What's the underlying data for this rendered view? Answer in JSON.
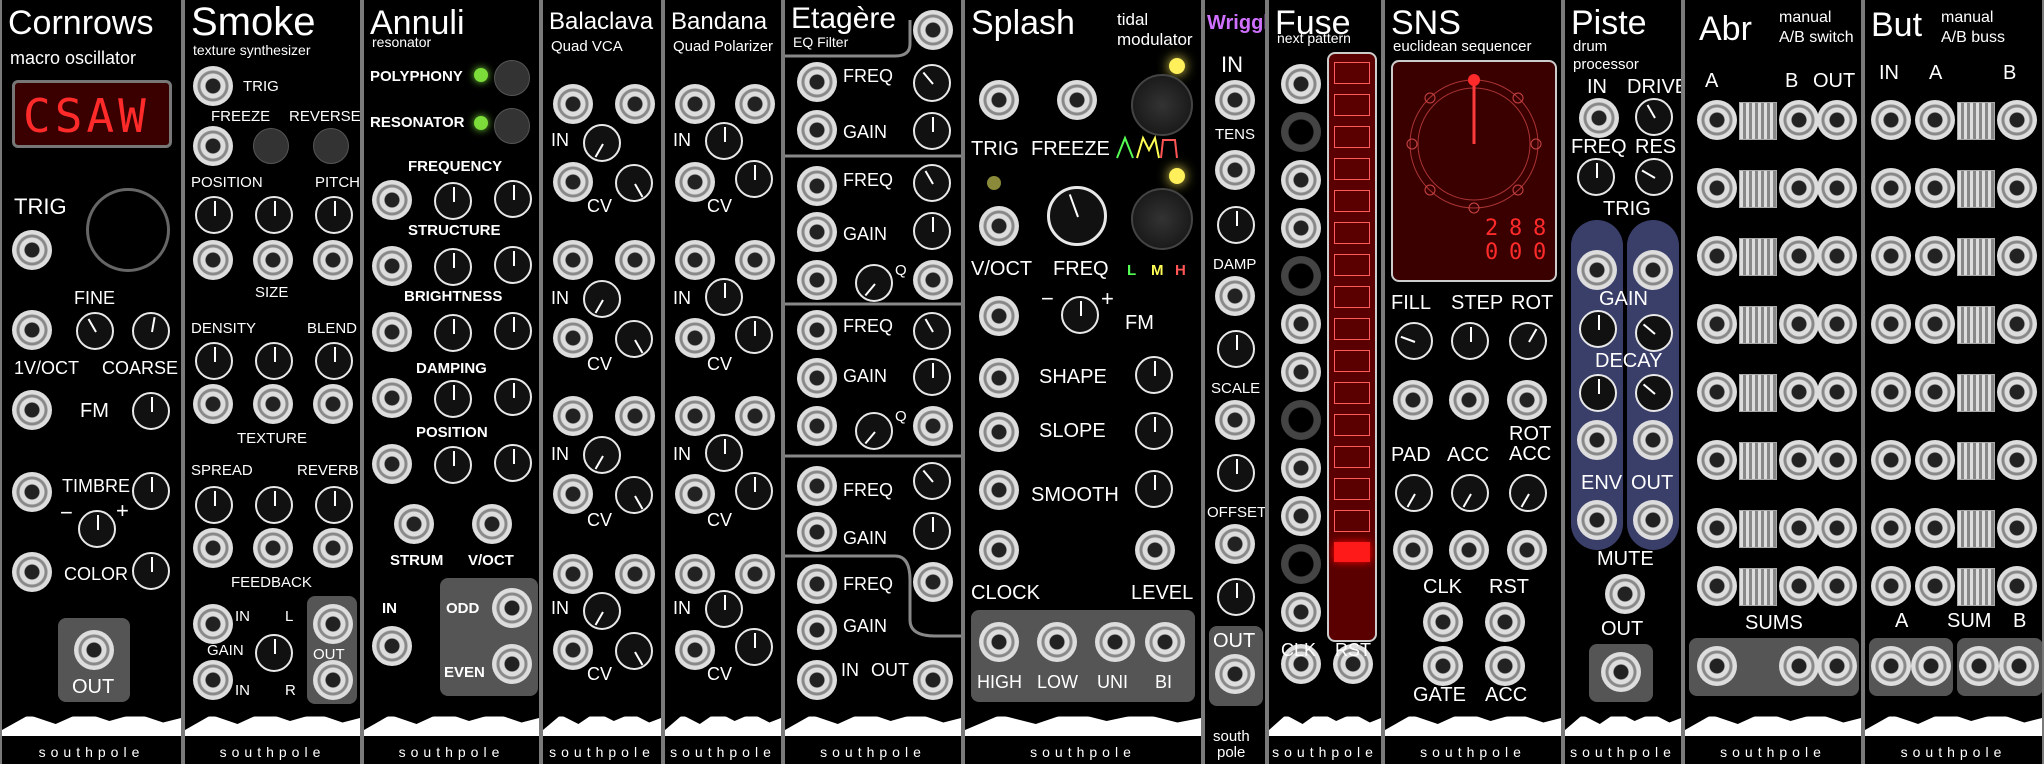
{
  "brand": "southpole",
  "modules": {
    "cornrows": {
      "title": "Cornrows",
      "subtitle": "macro oscillator",
      "display": "CSAW",
      "labels": {
        "trig": "TRIG",
        "fine": "FINE",
        "voct": "1V/OCT",
        "coarse": "COARSE",
        "fm": "FM",
        "timbre": "TIMBRE",
        "minus": "−",
        "plus": "+",
        "color": "COLOR",
        "out": "OUT"
      }
    },
    "smoke": {
      "title": "Smoke",
      "subtitle": "texture synthesizer",
      "labels": {
        "trig": "TRIG",
        "freeze": "FREEZE",
        "reverse": "REVERSE",
        "position": "POSITION",
        "pitch": "PITCH",
        "size": "SIZE",
        "density": "DENSITY",
        "blend": "BLEND",
        "texture": "TEXTURE",
        "spread": "SPREAD",
        "reverb": "REVERB",
        "feedback": "FEEDBACK",
        "in": "IN",
        "l": "L",
        "gain": "GAIN",
        "in2": "IN",
        "r": "R",
        "out": "OUT"
      }
    },
    "annuli": {
      "title": "Annuli",
      "subtitle": "resonator",
      "labels": {
        "polyphony": "POLYPHONY",
        "resonator": "RESONATOR",
        "frequency": "FREQUENCY",
        "structure": "STRUCTURE",
        "brightness": "BRIGHTNESS",
        "damping": "DAMPING",
        "position": "POSITION",
        "minus": "-",
        "plus": "+",
        "strum": "STRUM",
        "voct": "V/OCT",
        "in": "IN",
        "odd": "ODD",
        "even": "EVEN"
      }
    },
    "balaclava": {
      "title": "Balaclava",
      "subtitle": "Quad VCA",
      "labels": {
        "in": "IN",
        "cv": "CV"
      }
    },
    "bandana": {
      "title": "Bandana",
      "subtitle": "Quad Polarizer",
      "labels": {
        "in": "IN",
        "cv": "CV"
      }
    },
    "etagere": {
      "title": "Etagère",
      "subtitle": "EQ Filter",
      "labels": {
        "freq": "FREQ",
        "gain": "GAIN",
        "q": "Q",
        "in": "IN",
        "out": "OUT"
      }
    },
    "splash": {
      "title": "Splash",
      "subtitle": "tidal modulator",
      "labels": {
        "trig": "TRIG",
        "freeze": "FREEZE",
        "voct": "V/OCT",
        "freq": "FREQ",
        "l": "L",
        "m": "M",
        "h": "H",
        "minus": "−",
        "plus": "+",
        "fm": "FM",
        "shape": "SHAPE",
        "slope": "SLOPE",
        "smooth": "SMOOTH",
        "clock": "CLOCK",
        "level": "LEVEL",
        "high": "HIGH",
        "low": "LOW",
        "uni": "UNI",
        "bi": "BI"
      }
    },
    "wriggle": {
      "title": "Wriggle",
      "labels": {
        "in": "IN",
        "tens": "TENS",
        "damp": "DAMP",
        "scale": "SCALE",
        "offset": "OFFSET",
        "out": "OUT",
        "brand_a": "south",
        "brand_b": "pole"
      }
    },
    "fuse": {
      "title": "Fuse",
      "subtitle": "next pattern",
      "labels": {
        "clk": "CLK",
        "rst": "RST"
      }
    },
    "sns": {
      "title": "SNS",
      "subtitle": "euclidean sequencer",
      "digits_top": [
        "2",
        "8",
        "8"
      ],
      "digits_bottom": [
        "0",
        "0",
        "0"
      ],
      "labels": {
        "fill": "FILL",
        "step": "STEP",
        "rot": "ROT",
        "pad": "PAD",
        "acc": "ACC",
        "rot_acc": "ROT\nACC",
        "clk": "CLK",
        "rst": "RST",
        "gate": "GATE",
        "acc2": "ACC"
      }
    },
    "piste": {
      "title": "Piste",
      "subtitle": "drum processor",
      "labels": {
        "in": "IN",
        "drive": "DRIVE",
        "freq": "FREQ",
        "res": "RES",
        "trig": "TRIG",
        "gain": "GAIN",
        "decay": "DECAY",
        "env": "ENV",
        "out": "OUT",
        "mute": "MUTE",
        "out2": "OUT"
      }
    },
    "abr": {
      "title": "Abr",
      "subtitle": "manual A/B switch",
      "labels": {
        "a": "A",
        "b": "B",
        "out": "OUT",
        "sums": "SUMS"
      }
    },
    "but": {
      "title": "But",
      "subtitle": "manual A/B buss",
      "labels": {
        "in": "IN",
        "a": "A",
        "b": "B",
        "a2": "A",
        "sum": "SUM",
        "b2": "B"
      }
    }
  },
  "colors": {
    "led_green": "#7bdc3a",
    "led_yellow": "#ffef5a",
    "display_red": "#ff2a2a",
    "panel_grey": "#555555",
    "piste_blue": "#3a3f6a"
  }
}
